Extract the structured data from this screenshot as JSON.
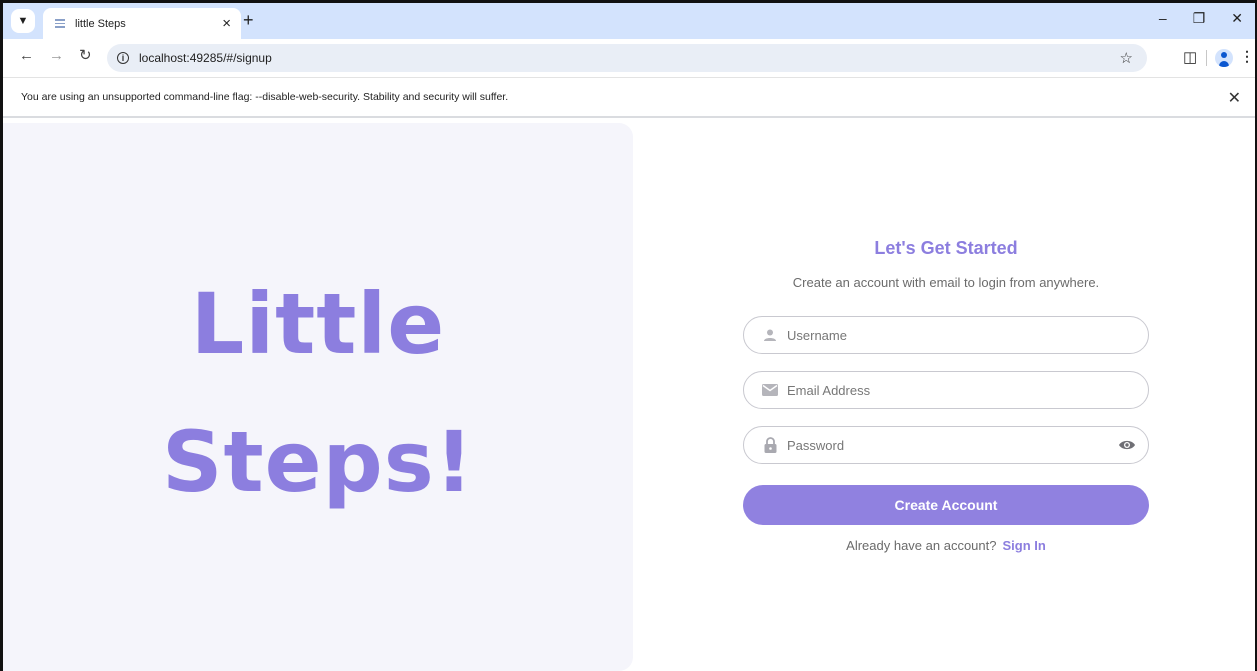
{
  "browser": {
    "tab_title": "little Steps",
    "tab_close": "×",
    "new_tab": "+",
    "url": "localhost:49285/#/signup",
    "controls": {
      "minimize": "–",
      "restore": "❐",
      "close": "✕"
    }
  },
  "infobar": {
    "message": "You are using an unsupported command-line flag: --disable-web-security. Stability and security will suffer.",
    "close": "✕"
  },
  "brand": {
    "line1": "Little",
    "line2": "Steps!"
  },
  "form": {
    "title": "Let's Get Started",
    "subtitle": "Create an account with email to login from anywhere.",
    "username_placeholder": "Username",
    "email_placeholder": "Email Address",
    "password_placeholder": "Password",
    "submit_label": "Create Account",
    "signin_prompt": "Already have an account?",
    "signin_link": "Sign In"
  },
  "icons": {
    "username": "person-icon",
    "email": "mail-icon",
    "password": "lock-icon",
    "visibility": "eye-icon"
  },
  "colors": {
    "accent": "#8c7edf",
    "button": "#9081e0",
    "panel": "#f5f5fb"
  }
}
